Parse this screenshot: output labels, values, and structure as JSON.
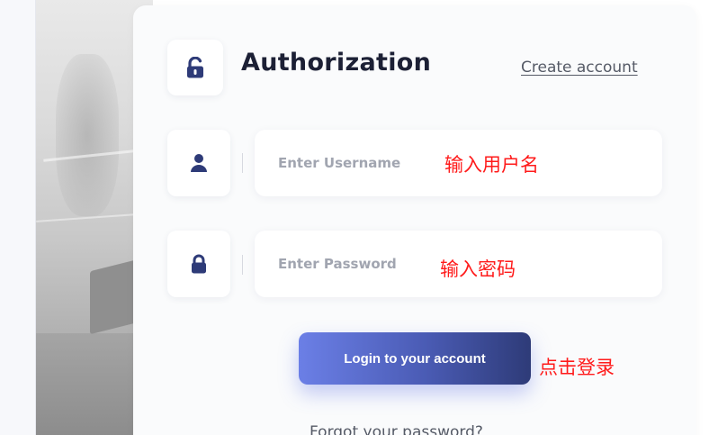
{
  "auth": {
    "title": "Authorization",
    "create_account": "Create account",
    "username_placeholder": "Enter Username",
    "password_placeholder": "Enter Password",
    "login_button": "Login to your account",
    "forgot_password": "Forgot your password?"
  },
  "annotations": {
    "username_note": "输入用户名",
    "password_note": "输入密码",
    "login_note": "点击登录"
  },
  "icons": {
    "header": "unlock-icon",
    "username": "user-icon",
    "password": "lock-icon"
  },
  "colors": {
    "accent": "#2e3b78",
    "button_start": "#6b7fe6",
    "button_end": "#2e3b78",
    "annotation": "#ff1b1b",
    "placeholder": "#a1a5b0"
  }
}
